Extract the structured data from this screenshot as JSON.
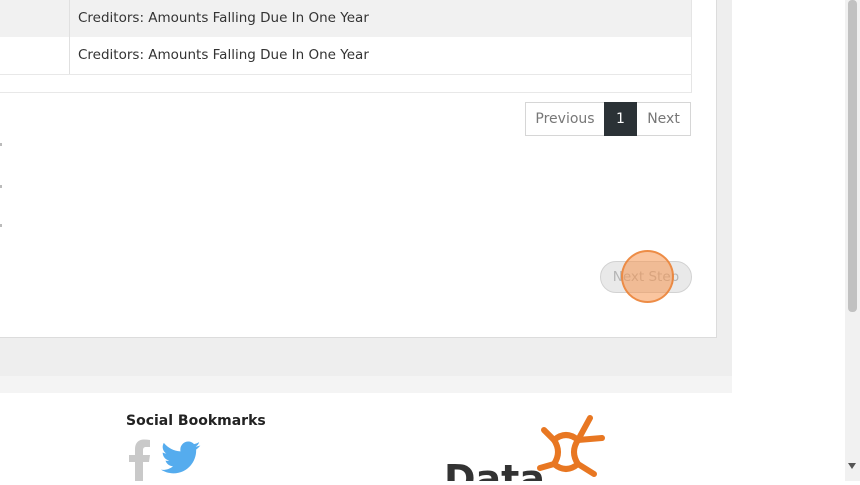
{
  "table": {
    "rows": [
      {
        "description": "Creditors: Amounts Falling Due In One Year"
      },
      {
        "description": "Creditors: Amounts Falling Due In One Year"
      }
    ]
  },
  "pagination": {
    "previous_label": "Previous",
    "current_page": "1",
    "next_label": "Next"
  },
  "actions": {
    "next_step_label": "Next Step"
  },
  "footer": {
    "social_title": "Social Bookmarks",
    "logo_text": "Data"
  },
  "icons": {
    "facebook": "facebook-icon",
    "twitter": "twitter-icon",
    "scroll_down": "chevron-down-icon"
  },
  "colors": {
    "active_page_bg": "#2b3236",
    "twitter_blue": "#55acee",
    "logo_orange": "#e87722",
    "click_marker": "#f59650"
  }
}
